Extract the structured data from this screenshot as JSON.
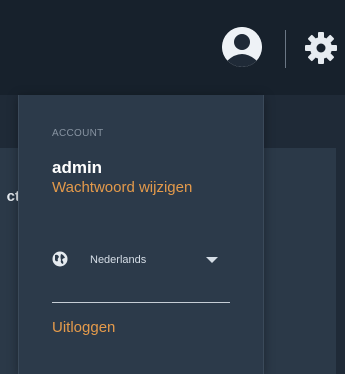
{
  "header": {
    "avatar_icon": "user-avatar-icon",
    "settings_icon": "gear-icon"
  },
  "background": {
    "partial_text": "ct"
  },
  "account_menu": {
    "section_label": "ACCOUNT",
    "username": "admin",
    "change_password_label": "Wachtwoord wijzigen",
    "language": {
      "icon": "globe-icon",
      "selected": "Nederlands"
    },
    "logout_label": "Uitloggen"
  },
  "colors": {
    "accent": "#e49a4b",
    "menu_background": "#2c3a4a",
    "topbar_background": "#17212c"
  }
}
